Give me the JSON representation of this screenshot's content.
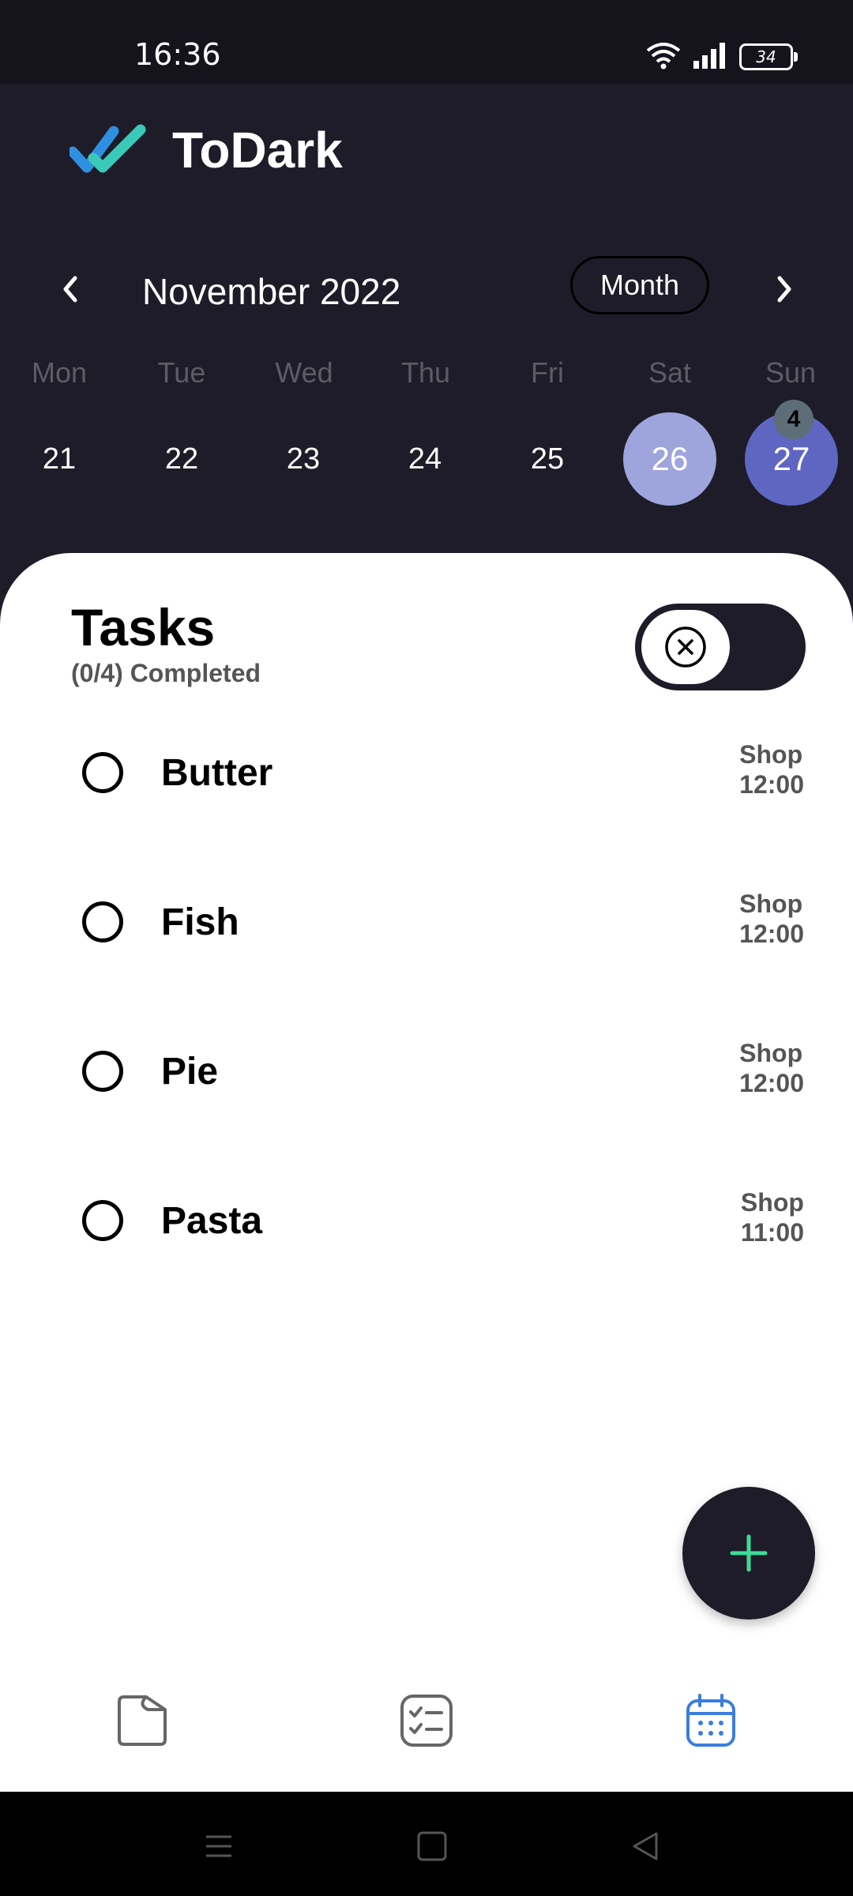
{
  "status_bar": {
    "time": "16:36",
    "battery": "34",
    "icons": [
      "wifi-icon",
      "signal-icon",
      "battery-icon"
    ]
  },
  "app": {
    "title": "ToDark"
  },
  "calendar": {
    "month_label": "November 2022",
    "view_button": "Month",
    "weekdays": [
      "Mon",
      "Tue",
      "Wed",
      "Thu",
      "Fri",
      "Sat",
      "Sun"
    ],
    "dates": [
      "21",
      "22",
      "23",
      "24",
      "25",
      "26",
      "27"
    ],
    "today": "26",
    "selected": "27",
    "selected_badge": "4"
  },
  "tasks": {
    "title": "Tasks",
    "subtitle": "(0/4) Completed",
    "items": [
      {
        "name": "Butter",
        "category": "Shop",
        "time": "12:00"
      },
      {
        "name": "Fish",
        "category": "Shop",
        "time": "12:00"
      },
      {
        "name": "Pie",
        "category": "Shop",
        "time": "12:00"
      },
      {
        "name": "Pasta",
        "category": "Shop",
        "time": "11:00"
      }
    ]
  },
  "bottom_nav": {
    "tabs": [
      "folder-icon",
      "checklist-icon",
      "calendar-icon"
    ],
    "active": "calendar-icon"
  },
  "colors": {
    "background": "#1d1c28",
    "accent": "#5e66c2",
    "today": "#9ea4dc",
    "fab_plus": "#3ddc97",
    "active_tab": "#3b7ddd"
  }
}
